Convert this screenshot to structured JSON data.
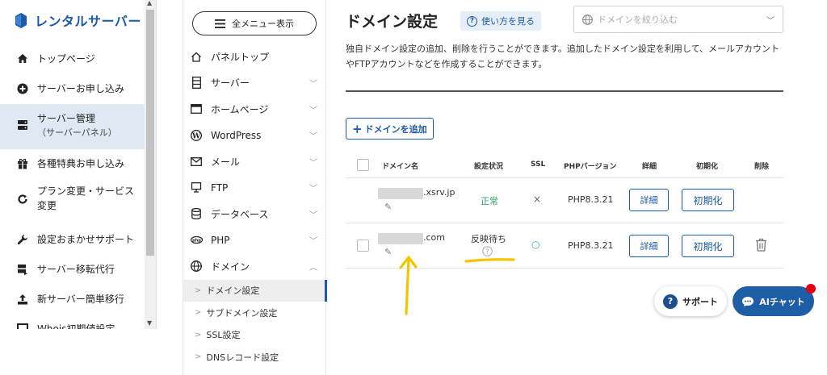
{
  "brand": {
    "name": "レンタルサーバー"
  },
  "sidebar": {
    "items": [
      {
        "label": "トップページ",
        "icon": "home-icon"
      },
      {
        "label": "サーバーお申し込み",
        "icon": "plus-circle-icon"
      },
      {
        "label": "サーバー管理",
        "sub": "（サーバーパネル）",
        "icon": "server-icon",
        "active": true
      },
      {
        "label": "各種特典お申し込み",
        "icon": "gift-icon"
      },
      {
        "label": "プラン変更・サービス変更",
        "icon": "refresh-icon"
      },
      {
        "label": "設定おまかせサポート",
        "icon": "wrench-icon"
      },
      {
        "label": "サーバー移転代行",
        "icon": "transfer-icon"
      },
      {
        "label": "新サーバー簡単移行",
        "icon": "upload-icon"
      },
      {
        "label": "Whois初期値設定",
        "icon": "whois-icon"
      }
    ]
  },
  "menu": {
    "all_label": "全メニュー表示",
    "items": [
      {
        "label": "パネルトップ",
        "icon": "home-icon"
      },
      {
        "label": "サーバー",
        "icon": "server-icon"
      },
      {
        "label": "ホームページ",
        "icon": "window-icon"
      },
      {
        "label": "WordPress",
        "icon": "wordpress-icon"
      },
      {
        "label": "メール",
        "icon": "mail-icon"
      },
      {
        "label": "FTP",
        "icon": "monitor-icon"
      },
      {
        "label": "データベース",
        "icon": "database-icon"
      },
      {
        "label": "PHP",
        "icon": "php-icon"
      },
      {
        "label": "ドメイン",
        "icon": "globe-icon"
      }
    ],
    "sub_items": [
      "ドメイン設定",
      "サブドメイン設定",
      "SSL設定",
      "DNSレコード設定"
    ]
  },
  "main": {
    "title": "ドメイン設定",
    "help_label": "使い方を見る",
    "filter_placeholder": "ドメインを絞り込む",
    "description": "独自ドメイン設定の追加、削除を行うことができます。追加したドメイン設定を利用して、メールアカウントやFTPアカウントなどを作成することができます。",
    "add_label": "ドメインを追加"
  },
  "table": {
    "headers": {
      "domain": "ドメイン名",
      "status": "設定状況",
      "ssl": "SSL",
      "php": "PHPバージョン",
      "detail": "詳細",
      "init": "初期化",
      "delete": "削除"
    },
    "rows": [
      {
        "suffix": ".xsrv.jp",
        "status": "正常",
        "ssl": "×",
        "php": "PHP8.3.21",
        "detail": "詳細",
        "init": "初期化",
        "deletable": false
      },
      {
        "suffix": ".com",
        "status": "反映待ち",
        "ssl": "○",
        "php": "PHP8.3.21",
        "detail": "詳細",
        "init": "初期化",
        "deletable": true
      }
    ]
  },
  "floating": {
    "support_label": "サポート",
    "ai_label": "AIチャット"
  },
  "colors": {
    "brand_blue": "#1b5aa8",
    "status_ok": "#2aa36b",
    "status_pending": "#333333",
    "ssl_ok": "#35b0b3",
    "annotation_yellow": "#f5c400",
    "badge_red": "#e60012"
  }
}
